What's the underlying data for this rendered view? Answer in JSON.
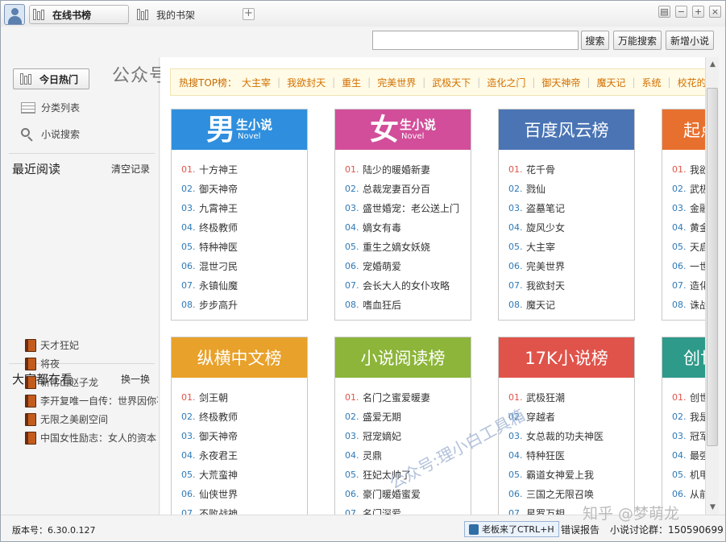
{
  "titlebar": {
    "tabs": [
      {
        "label": "在线书榜",
        "active": true
      },
      {
        "label": "我的书架",
        "active": false
      }
    ],
    "add_tab": "+",
    "window_buttons": {
      "skin": "▤",
      "minimize": "−",
      "maximize": "+",
      "close": "×"
    }
  },
  "search": {
    "placeholder": "",
    "value": "",
    "buttons": [
      "搜索",
      "万能搜索",
      "新增小说"
    ]
  },
  "sidebar": {
    "nav": {
      "today_hot": "今日热门",
      "category_list": "分类列表",
      "novel_search": "小说搜索"
    },
    "recent": {
      "title": "最近阅读",
      "action": "清空记录"
    },
    "popular": {
      "title": "大家都在看",
      "action": "换一换",
      "items": [
        "天才狂妃",
        "将夜",
        "新常山赵子龙",
        "李开复唯一自传：世界因你不同",
        "无限之美剧空间",
        "中国女性励志：女人的资本"
      ]
    }
  },
  "watermark_top": "公众号:理小白工具箱",
  "watermark_diag": "公众号:理小白工具箱",
  "watermark_zhihu": "知乎 @梦萌龙",
  "hotbar": {
    "label": "热搜TOP榜：",
    "keywords": [
      "大主宰",
      "我欲封天",
      "重生",
      "完美世界",
      "武极天下",
      "造化之门",
      "御天神帝",
      "魔天记",
      "系统",
      "校花的贴身高手"
    ]
  },
  "cards": [
    {
      "title_big": "男",
      "title_s1": "生小说",
      "title_s2": "Novel",
      "style": "logo",
      "color": "#2f8fde",
      "items": [
        "十方神王",
        "御天神帝",
        "九霄神王",
        "终极教师",
        "特种神医",
        "混世刁民",
        "永镇仙魔",
        "步步高升"
      ]
    },
    {
      "title_big": "女",
      "title_s1": "生小说",
      "title_s2": "Novel",
      "style": "logo",
      "color": "#d24e9a",
      "items": [
        "陆少的暖婚新妻",
        "总裁宠妻百分百",
        "盛世婚宠：老公送上门",
        "嫡女有毒",
        "重生之嫡女妖娆",
        "宠婚萌爱",
        "会长大人的女仆攻略",
        "嗜血狂后"
      ]
    },
    {
      "title": "百度风云榜",
      "style": "plain",
      "color": "#4a74b4",
      "items": [
        "花千骨",
        "戮仙",
        "盗墓笔记",
        "旋风少女",
        "大主宰",
        "完美世界",
        "我欲封天",
        "魔天记"
      ]
    },
    {
      "title": "起点",
      "style": "plain",
      "color": "#e8702e",
      "items": [
        "我欲",
        "武极",
        "金融",
        "黄金",
        "天启",
        "一世",
        "造化",
        "诛战"
      ]
    },
    {
      "title": "纵横中文榜",
      "style": "plain",
      "color": "#e8a12a",
      "items": [
        "剑王朝",
        "终极教师",
        "御天神帝",
        "永夜君王",
        "大荒蛮神",
        "仙侠世界",
        "不败战神"
      ]
    },
    {
      "title": "小说阅读榜",
      "style": "plain",
      "color": "#8cb53a",
      "items": [
        "名门之蜜爱暖妻",
        "盛爱无期",
        "冠宠嫡妃",
        "灵鼎",
        "狂妃太帅了",
        "豪门暖婚蜜爱",
        "名门深爱"
      ]
    },
    {
      "title": "17K小说榜",
      "style": "plain",
      "color": "#e0534a",
      "items": [
        "武极狂潮",
        "穿越者",
        "女总裁的功夫神医",
        "特种狂医",
        "霸道女神爱上我",
        "三国之无限召唤",
        "星罗万相"
      ]
    },
    {
      "title": "创世",
      "style": "plain",
      "color": "#2e9a8a",
      "items": [
        "创世",
        "我是",
        "冠军",
        "最强",
        "机甲",
        "从前"
      ]
    }
  ],
  "status": {
    "version": "版本号：6.30.0.127",
    "boss": "老板来了CTRL+H",
    "error": "错误报告",
    "group": "小说讨论群：150590699"
  }
}
